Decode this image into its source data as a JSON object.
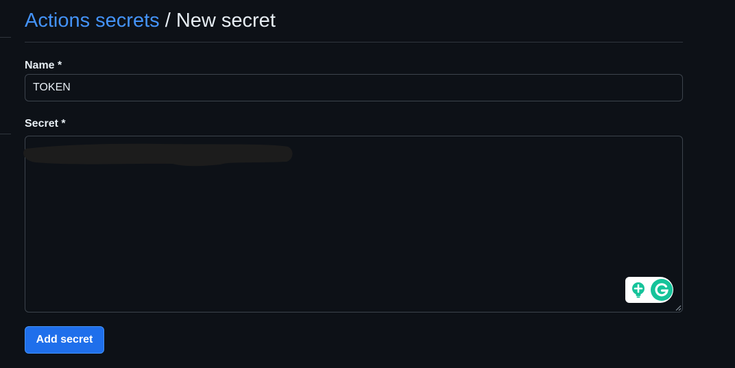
{
  "breadcrumb": {
    "link": "Actions secrets",
    "separator": "/",
    "current": "New secret"
  },
  "form": {
    "name_label": "Name *",
    "name_value": "TOKEN",
    "secret_label": "Secret *",
    "secret_value": "",
    "submit_label": "Add secret"
  },
  "icons": {
    "grammarly_hint": "lightbulb-icon",
    "grammarly_logo": "grammarly-g-icon"
  },
  "colors": {
    "background": "#0d1117",
    "link": "#4493f8",
    "primary_button": "#1f6feb",
    "grammarly_green": "#15c39a"
  }
}
